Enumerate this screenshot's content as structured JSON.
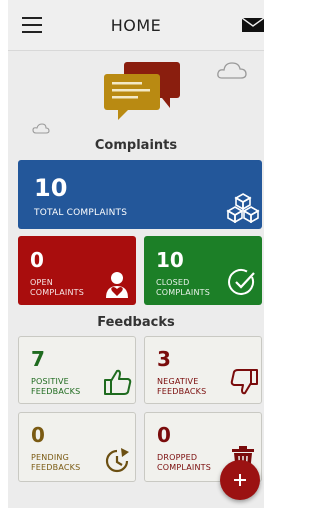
{
  "header": {
    "title": "HOME"
  },
  "complaints": {
    "section_title": "Complaints",
    "total": {
      "value": "10",
      "label": "TOTAL COMPLAINTS"
    },
    "open": {
      "value": "0",
      "label_line1": "OPEN",
      "label_line2": "COMPLAINTS"
    },
    "closed": {
      "value": "10",
      "label_line1": "CLOSED",
      "label_line2": "COMPLAINTS"
    }
  },
  "feedbacks": {
    "section_title": "Feedbacks",
    "positive": {
      "value": "7",
      "label_line1": "POSITIVE",
      "label_line2": "FEEDBACKS"
    },
    "negative": {
      "value": "3",
      "label_line1": "NEGATIVE",
      "label_line2": "FEEDBACKS"
    },
    "pending": {
      "value": "0",
      "label_line1": "PENDING",
      "label_line2": "FEEDBACKS"
    },
    "dropped": {
      "value": "0",
      "label_line1": "DROPPED",
      "label_line2": "COMPLAINTS"
    }
  },
  "icons": {
    "menu": "hamburger-menu-icon",
    "mail": "mail-icon",
    "total": "cubes-icon",
    "open": "person-heart-icon",
    "closed": "check-circle-icon",
    "positive": "thumbs-up-icon",
    "negative": "thumbs-down-icon",
    "pending": "clock-refresh-icon",
    "dropped": "trash-icon",
    "fab": "plus-icon"
  },
  "colors": {
    "total": "#23579a",
    "open": "#a90d0d",
    "closed": "#1c7f27",
    "fab": "#9b1212"
  }
}
